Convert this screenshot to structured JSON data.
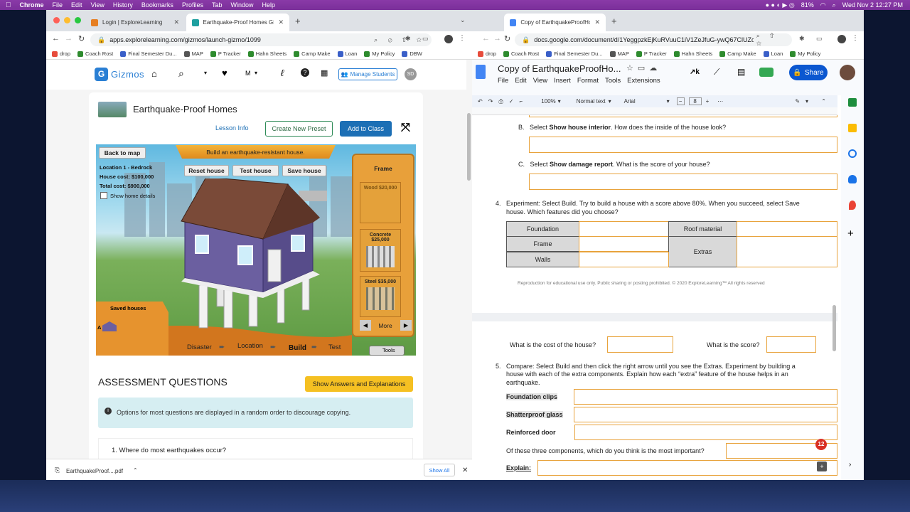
{
  "menubar": {
    "app": "Chrome",
    "items": [
      "File",
      "Edit",
      "View",
      "History",
      "Bookmarks",
      "Profiles",
      "Tab",
      "Window",
      "Help"
    ],
    "battery": "81%",
    "datetime": "Wed Nov 2  12:27 PM"
  },
  "left_window": {
    "tabs": [
      {
        "label": "Login | ExploreLearning",
        "color": "#e67e22"
      },
      {
        "label": "Earthquake-Proof Homes Gizmo",
        "color": "#1ea0a0"
      }
    ],
    "url": "apps.explorelearning.com/gizmos/launch-gizmo/1099",
    "bookmarks": [
      "drop",
      "Coach Rost",
      "Final Semester Du...",
      "MAP",
      "P Tracker",
      "Hahn Sheets",
      "Camp Make",
      "Loan",
      "My Policy",
      "DBW"
    ]
  },
  "gizmos": {
    "logo_text": "Gizmos",
    "nav_m": "M",
    "manage_students": "Manage Students",
    "avatar": "SD",
    "title": "Earthquake-Proof Homes",
    "lesson_info": "Lesson Info",
    "create_preset": "Create New Preset",
    "add_to_class": "Add to Class",
    "scene": {
      "back": "Back to map",
      "banner": "Build an earthquake-resistant house.",
      "location": "Location 1 - Bedrock",
      "house_cost": "House cost: $100,000",
      "total_cost": "Total cost: $900,000",
      "show_details": "Show home details",
      "reset": "Reset house",
      "test": "Test house",
      "save": "Save house",
      "frame": "Frame",
      "wood": "Wood $20,000",
      "concrete": "Concrete $25,000",
      "steel": "Steel $35,000",
      "more": "More",
      "saved_houses": "Saved houses",
      "saved_label": "A",
      "steps": [
        "Disaster",
        "Location",
        "Build",
        "Test"
      ],
      "tools": "Tools"
    },
    "assessment_title": "ASSESSMENT QUESTIONS",
    "show_answers": "Show Answers and Explanations",
    "notice": "Options for most questions are displayed in a random order to discourage copying.",
    "q1": "1. Where do most earthquakes occur?"
  },
  "download": {
    "file": "EarthquakeProof....pdf",
    "show_all": "Show All"
  },
  "right_window": {
    "tab": "Copy of EarthquakeProofHome",
    "url": "docs.google.com/document/d/1YeggpzkEjKuRVuuC1iV1ZeJfuG-ywQ67ClUZo...",
    "bookmarks": [
      "drop",
      "Coach Rost",
      "Final Semester Du...",
      "MAP",
      "P Tracker",
      "Hahn Sheets",
      "Camp Make",
      "Loan",
      "My Policy"
    ],
    "doc_title": "Copy of EarthquakeProofHo...",
    "menus": [
      "File",
      "Edit",
      "View",
      "Insert",
      "Format",
      "Tools",
      "Extensions"
    ],
    "share": "Share",
    "toolbar": {
      "zoom": "100%",
      "style": "Normal text",
      "font": "Arial",
      "size": "8"
    },
    "doc": {
      "b_prefix": "B.",
      "b_pre": "Select ",
      "b_bold": "Show house interior",
      "b_post": ". How does the inside of the house look?",
      "c_prefix": "C.",
      "c_pre": "Select ",
      "c_bold": "Show damage report",
      "c_post": ". What is the score of your house?",
      "q4_num": "4.",
      "q4_line1": "Experiment: Select Build. Try to build a house with a score above 80%. When you succeed, select Save",
      "q4_line2": "house. Which features did you choose?",
      "tbl": {
        "foundation": "Foundation",
        "frame": "Frame",
        "walls": "Walls",
        "roof": "Roof material",
        "extras": "Extras"
      },
      "footer": "Reproduction for educational use only. Public sharing or posting prohibited. © 2020 ExploreLearning™ All rights reserved",
      "cost_q": "What is the cost of the house?",
      "score_q": "What is the score?",
      "q5_num": "5.",
      "q5_line1": "Compare: Select Build and then click the right arrow until you see the Extras. Experiment by building a",
      "q5_line2": "house with each of the extra components. Explain how each “extra” feature of the house helps in an",
      "q5_line3": "earthquake.",
      "clips": "Foundation clips",
      "glass": "Shatterproof glass",
      "door": "Reinforced door",
      "important_q": "Of these three components, which do you think is the most important?",
      "explain": "Explain:",
      "badge": "12"
    }
  }
}
